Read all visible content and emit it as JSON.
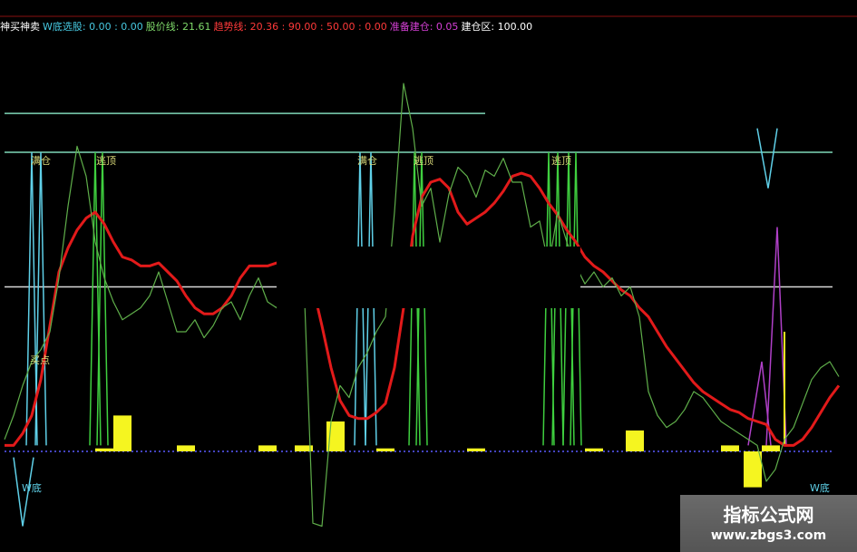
{
  "header": {
    "indicator_name": "神买神卖",
    "w_bottom": "W底选股: 0.00 : 0.00",
    "stock_price": "股价线: 21.61",
    "trend": "趋势线: 20.36 : 90.00 : 50.00 : 0.00",
    "prepare_build": "准备建仓: 0.05",
    "build_zone": "建仓区: 100.00"
  },
  "colors": {
    "header_white": "#ffffff",
    "header_cyan": "#47c8e0",
    "header_green": "#7fd96a",
    "header_red": "#ff3a3a",
    "header_magenta": "#d640d6",
    "trend": "#e21a1a",
    "price": "#5fae4a",
    "signal_green": "#3fcf3f",
    "signal_cyan": "#5fd0e8",
    "volume": "#f5f520",
    "level_top": "#7fd7b8",
    "level_mid": "#d8d8d8",
    "purple": "#b040c8",
    "base": "#5a5aff",
    "label": "#d8d878"
  },
  "chart_data": {
    "type": "line",
    "ylim": [
      -20,
      120
    ],
    "x": [
      0,
      10,
      20,
      30,
      40,
      50,
      60,
      70,
      80,
      90,
      100,
      110,
      120,
      130,
      140,
      150,
      160,
      170,
      180,
      190,
      200,
      210,
      220,
      230,
      240,
      250,
      260,
      270,
      280,
      290,
      300,
      310,
      320,
      330,
      340,
      350,
      360,
      370,
      380,
      390,
      400,
      410,
      420,
      430,
      440,
      450,
      460,
      470,
      480,
      490,
      500,
      510,
      520,
      530,
      540,
      550,
      560,
      570,
      580,
      590,
      600,
      610,
      620,
      630,
      640,
      650,
      660,
      670,
      680,
      690,
      700,
      710,
      720,
      730,
      740,
      750,
      760,
      770,
      780,
      790,
      800,
      810,
      820,
      830,
      840,
      850,
      860,
      870,
      880,
      890,
      900,
      910,
      920
    ],
    "levels": {
      "top": 100,
      "upper": 113,
      "mid": 55,
      "base": 0
    },
    "series": [
      {
        "key": "trend",
        "values": [
          2,
          2,
          6,
          12,
          24,
          42,
          60,
          68,
          74,
          78,
          80,
          76,
          70,
          65,
          64,
          62,
          62,
          63,
          60,
          57,
          52,
          48,
          46,
          46,
          48,
          52,
          58,
          62,
          62,
          62,
          63,
          62,
          60,
          59,
          55,
          42,
          28,
          17,
          12,
          11,
          11,
          13,
          16,
          28,
          48,
          72,
          85,
          90,
          91,
          88,
          80,
          76,
          78,
          80,
          83,
          87,
          92,
          93,
          92,
          88,
          83,
          79,
          74,
          70,
          65,
          62,
          60,
          57,
          54,
          52,
          48,
          45,
          40,
          35,
          31,
          27,
          23,
          20,
          18,
          16,
          14,
          13,
          11,
          10,
          9,
          4,
          2,
          2,
          4,
          8,
          13,
          18,
          22
        ]
      },
      {
        "key": "price",
        "values": [
          4,
          12,
          22,
          30,
          34,
          40,
          58,
          82,
          102,
          92,
          70,
          58,
          50,
          44,
          46,
          48,
          52,
          60,
          50,
          40,
          40,
          44,
          38,
          42,
          48,
          50,
          44,
          52,
          58,
          50,
          48,
          56,
          62,
          58,
          -24,
          -25,
          10,
          22,
          18,
          28,
          33,
          40,
          45,
          80,
          123,
          108,
          82,
          88,
          70,
          86,
          95,
          92,
          85,
          94,
          92,
          98,
          90,
          90,
          75,
          77,
          62,
          80,
          70,
          62,
          56,
          60,
          55,
          58,
          52,
          55,
          45,
          20,
          12,
          8,
          10,
          14,
          20,
          18,
          14,
          10,
          8,
          6,
          4,
          2,
          -10,
          -6,
          4,
          8,
          16,
          24,
          28,
          30,
          25
        ]
      }
    ],
    "volume_bars": [
      {
        "x": 130,
        "value": 12
      },
      {
        "x": 365,
        "value": 10
      },
      {
        "x": 695,
        "value": 7
      },
      {
        "x": 110,
        "value": 1
      },
      {
        "x": 200,
        "value": 2
      },
      {
        "x": 290,
        "value": 2
      },
      {
        "x": 330,
        "value": 2
      },
      {
        "x": 420,
        "value": 1
      },
      {
        "x": 520,
        "value": 1
      },
      {
        "x": 650,
        "value": 1
      },
      {
        "x": 800,
        "value": 2
      },
      {
        "x": 845,
        "value": 2
      },
      {
        "x": 825,
        "value": -12
      }
    ],
    "labels": {
      "full_position_1": "满仓",
      "escape_top_1": "逃顶",
      "full_position_2": "满仓",
      "escape_top_2": "逃顶",
      "escape_top_3": "逃顶",
      "buy_point": "买点",
      "w_bottom_1": "W底",
      "w_bottom_2": "W底"
    }
  },
  "watermark": {
    "title": "指标公式网",
    "url": "www.zbgs3.com"
  }
}
